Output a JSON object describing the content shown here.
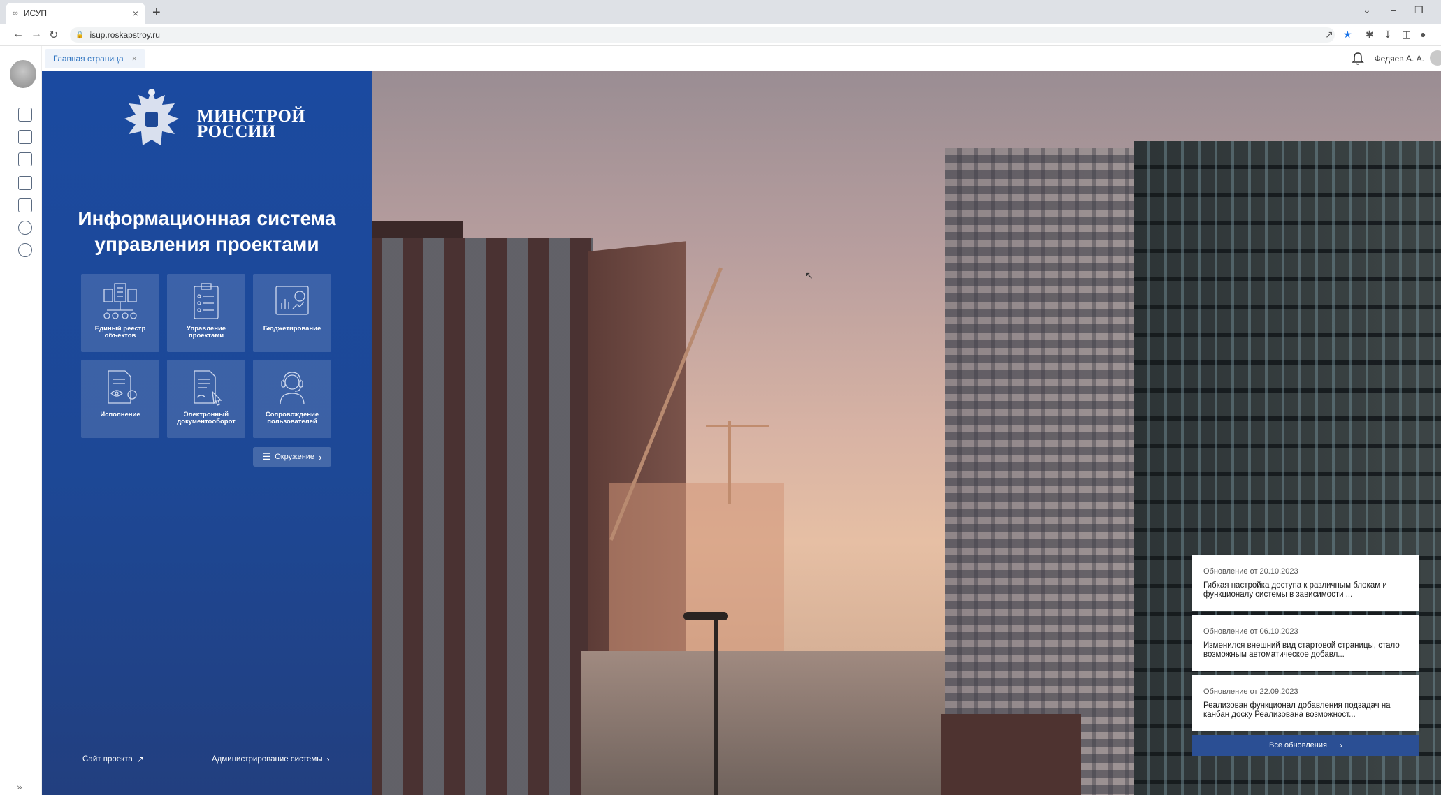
{
  "browser": {
    "tab_title": "ИСУП",
    "tab_close": "×",
    "new_tab": "+",
    "url": "isup.roskapstroy.ru"
  },
  "app": {
    "open_tab": "Главная страница",
    "open_tab_close": "×",
    "user_name": "Федяев А. А."
  },
  "panel": {
    "ministry_line1": "МИНСТРОЙ",
    "ministry_line2": "РОССИИ",
    "title_line1": "Информационная система",
    "title_line2": "управления проектами",
    "tiles": [
      {
        "label": "Единый реестр объектов",
        "icon": "registry-icon"
      },
      {
        "label": "Управление проектами",
        "icon": "clipboard-icon"
      },
      {
        "label": "Бюджетирование",
        "icon": "budget-chart-icon"
      },
      {
        "label": "Исполнение",
        "icon": "document-eye-icon"
      },
      {
        "label": "Электронный документооборот",
        "icon": "document-click-icon"
      },
      {
        "label": "Сопровождение пользователей",
        "icon": "support-operator-icon"
      }
    ],
    "env_button": "Окружение",
    "site_link": "Сайт проекта",
    "admin_link": "Администрирование системы"
  },
  "updates": {
    "items": [
      {
        "prefix": "Обновление  от",
        "date": "20.10.2023",
        "text": "Гибкая настройка доступа к различным блокам и функционалу системы в зависимости ..."
      },
      {
        "prefix": "Обновление  от",
        "date": "06.10.2023",
        "text": "Изменился внешний вид стартовой страницы, стало возможным автоматическое  добавл..."
      },
      {
        "prefix": "Обновление  от",
        "date": "22.09.2023",
        "text": "Реализован функционал добавления подзадач на канбан доску Реализована возможност..."
      }
    ],
    "all_button": "Все обновления"
  },
  "colors": {
    "panel_blue": "#1d4896",
    "accent_link": "#2f74c0",
    "button_blue": "#2b4f94"
  }
}
